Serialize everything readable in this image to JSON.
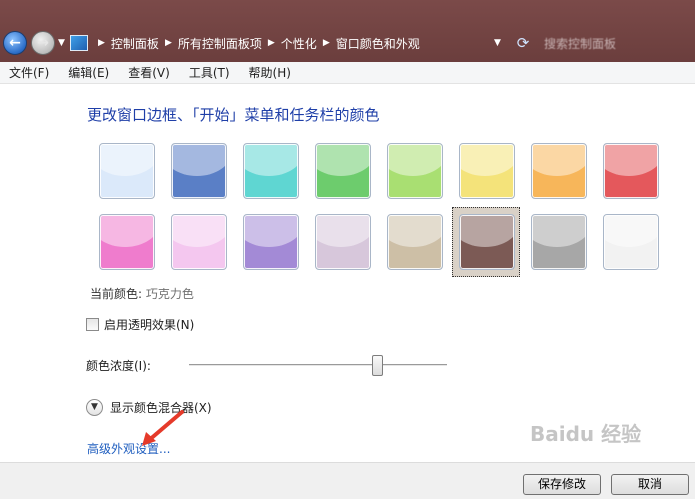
{
  "address_bar": {
    "breadcrumbs": [
      "控制面板",
      "所有控制面板项",
      "个性化",
      "窗口颜色和外观"
    ],
    "search_placeholder": "搜索控制面板"
  },
  "menu": [
    "文件(F)",
    "编辑(E)",
    "查看(V)",
    "工具(T)",
    "帮助(H)"
  ],
  "heading": "更改窗口边框、「开始」菜单和任务栏的颜色",
  "swatches": [
    {
      "name": "sky",
      "color": "#dbe9fa"
    },
    {
      "name": "twilight",
      "color": "#5a7fc6"
    },
    {
      "name": "sea",
      "color": "#5fd6d2"
    },
    {
      "name": "leaf",
      "color": "#6dcc6d"
    },
    {
      "name": "lime",
      "color": "#a9df72"
    },
    {
      "name": "pumpkin",
      "color": "#f4e37a"
    },
    {
      "name": "orange",
      "color": "#f7b65a"
    },
    {
      "name": "ruby",
      "color": "#e4585c"
    },
    {
      "name": "fuchsia",
      "color": "#ef7ccd"
    },
    {
      "name": "blush",
      "color": "#f4c7ef"
    },
    {
      "name": "violet",
      "color": "#a38ad6"
    },
    {
      "name": "lavender",
      "color": "#d7c7db"
    },
    {
      "name": "taupe",
      "color": "#cdbfa6"
    },
    {
      "name": "chocolate",
      "color": "#7c5a55"
    },
    {
      "name": "slate",
      "color": "#a7a7a7"
    },
    {
      "name": "frost",
      "color": "#f2f2f2"
    }
  ],
  "selected_swatch": "chocolate",
  "current_color": {
    "label": "当前颜色:",
    "value": "巧克力色"
  },
  "transparency": {
    "label": "启用透明效果(N)",
    "checked": false
  },
  "intensity": {
    "label": "颜色浓度(I):",
    "value_fraction": 0.73
  },
  "mixer": {
    "label": "显示颜色混合器(X)"
  },
  "advanced_link": "高级外观设置...",
  "buttons": {
    "save": "保存修改",
    "cancel": "取消"
  },
  "accent_colors": {
    "titlebar": "#6b3e3d",
    "link": "#1f5ebf",
    "arrow": "#e53a2a"
  }
}
